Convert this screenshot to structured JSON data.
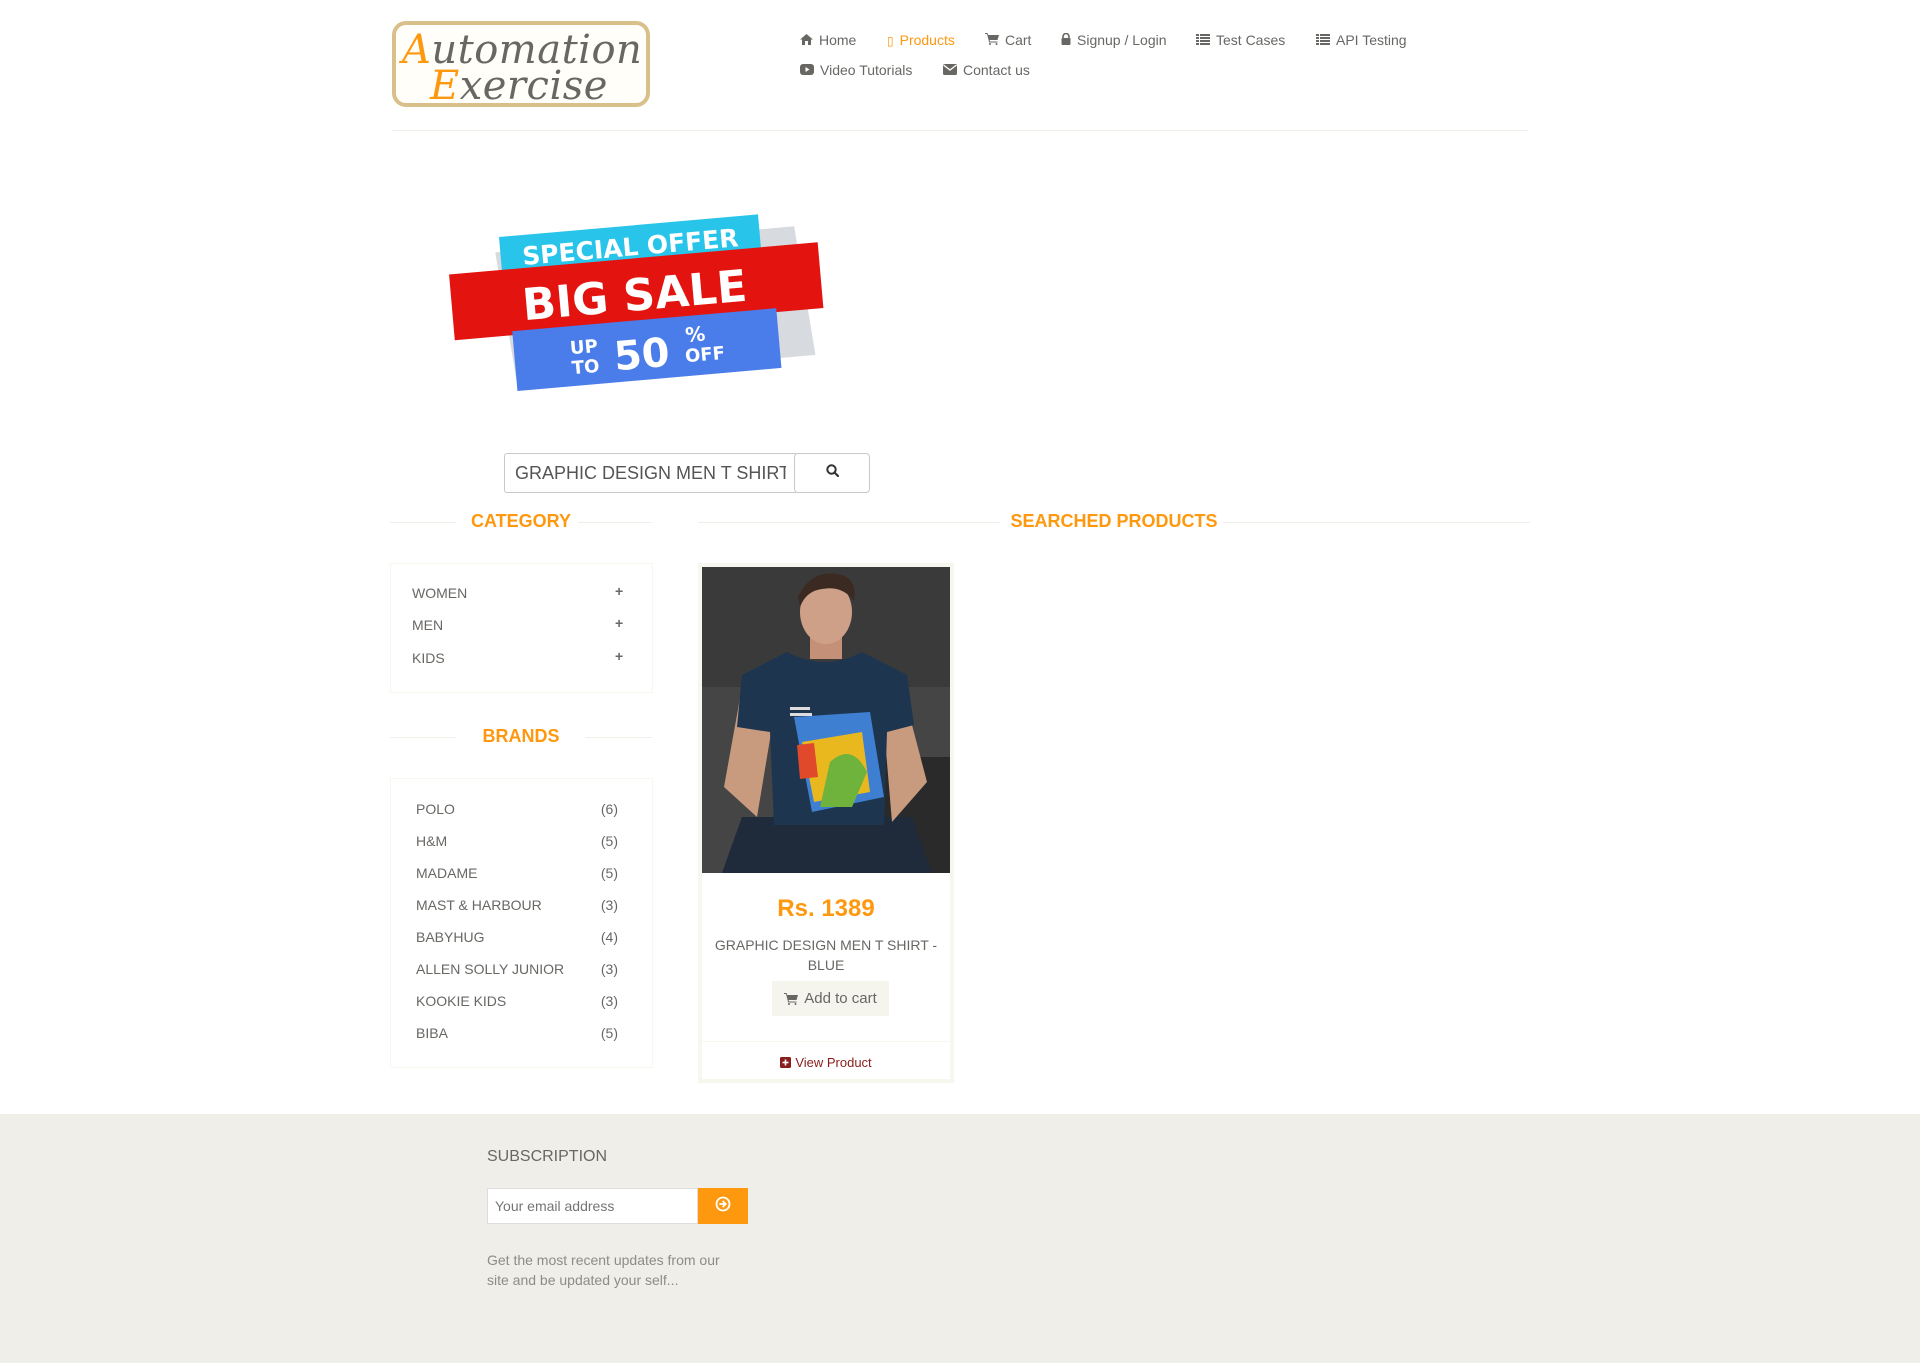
{
  "header": {
    "logo": {
      "cap1": "A",
      "rest1": "utomation",
      "cap2": "E",
      "rest2": "xercise"
    },
    "nav": [
      {
        "label": "Home",
        "icon": "home-icon"
      },
      {
        "label": "Products",
        "icon": "tshirt-icon",
        "active": true
      },
      {
        "label": "Cart",
        "icon": "cart-icon"
      },
      {
        "label": "Signup / Login",
        "icon": "lock-icon"
      },
      {
        "label": "Test Cases",
        "icon": "list-icon"
      },
      {
        "label": "API Testing",
        "icon": "list-icon"
      },
      {
        "label": "Video Tutorials",
        "icon": "youtube-icon"
      },
      {
        "label": "Contact us",
        "icon": "envelope-icon"
      }
    ]
  },
  "banner": {
    "line1": "SPECIAL OFFER",
    "line2": "BIG SALE",
    "up": "UP",
    "to": "TO",
    "pct": "50",
    "pct_sign": "%",
    "off": "OFF"
  },
  "search": {
    "value": "GRAPHIC DESIGN MEN T SHIRT",
    "icon": "search-icon"
  },
  "sidebar": {
    "category_title": "CATEGORY",
    "categories": [
      "WOMEN",
      "MEN",
      "KIDS"
    ],
    "brands_title": "BRANDS",
    "brands": [
      {
        "name": "POLO",
        "count": "(6)"
      },
      {
        "name": "H&M",
        "count": "(5)"
      },
      {
        "name": "MADAME",
        "count": "(5)"
      },
      {
        "name": "MAST & HARBOUR",
        "count": "(3)"
      },
      {
        "name": "BABYHUG",
        "count": "(4)"
      },
      {
        "name": "ALLEN SOLLY JUNIOR",
        "count": "(3)"
      },
      {
        "name": "KOOKIE KIDS",
        "count": "(3)"
      },
      {
        "name": "BIBA",
        "count": "(5)"
      }
    ]
  },
  "products": {
    "title": "SEARCHED PRODUCTS",
    "items": [
      {
        "price": "Rs. 1389",
        "name": "GRAPHIC DESIGN MEN T SHIRT - BLUE",
        "add_to_cart": "Add to cart",
        "view": "View Product"
      }
    ]
  },
  "footer": {
    "subscription_title": "SUBSCRIPTION",
    "email_placeholder": "Your email address",
    "subscribe_text": "Get the most recent updates from our site and be updated your self..."
  },
  "colors": {
    "accent": "#fe980f",
    "text": "#696763",
    "footer_bg": "#efeee8"
  }
}
